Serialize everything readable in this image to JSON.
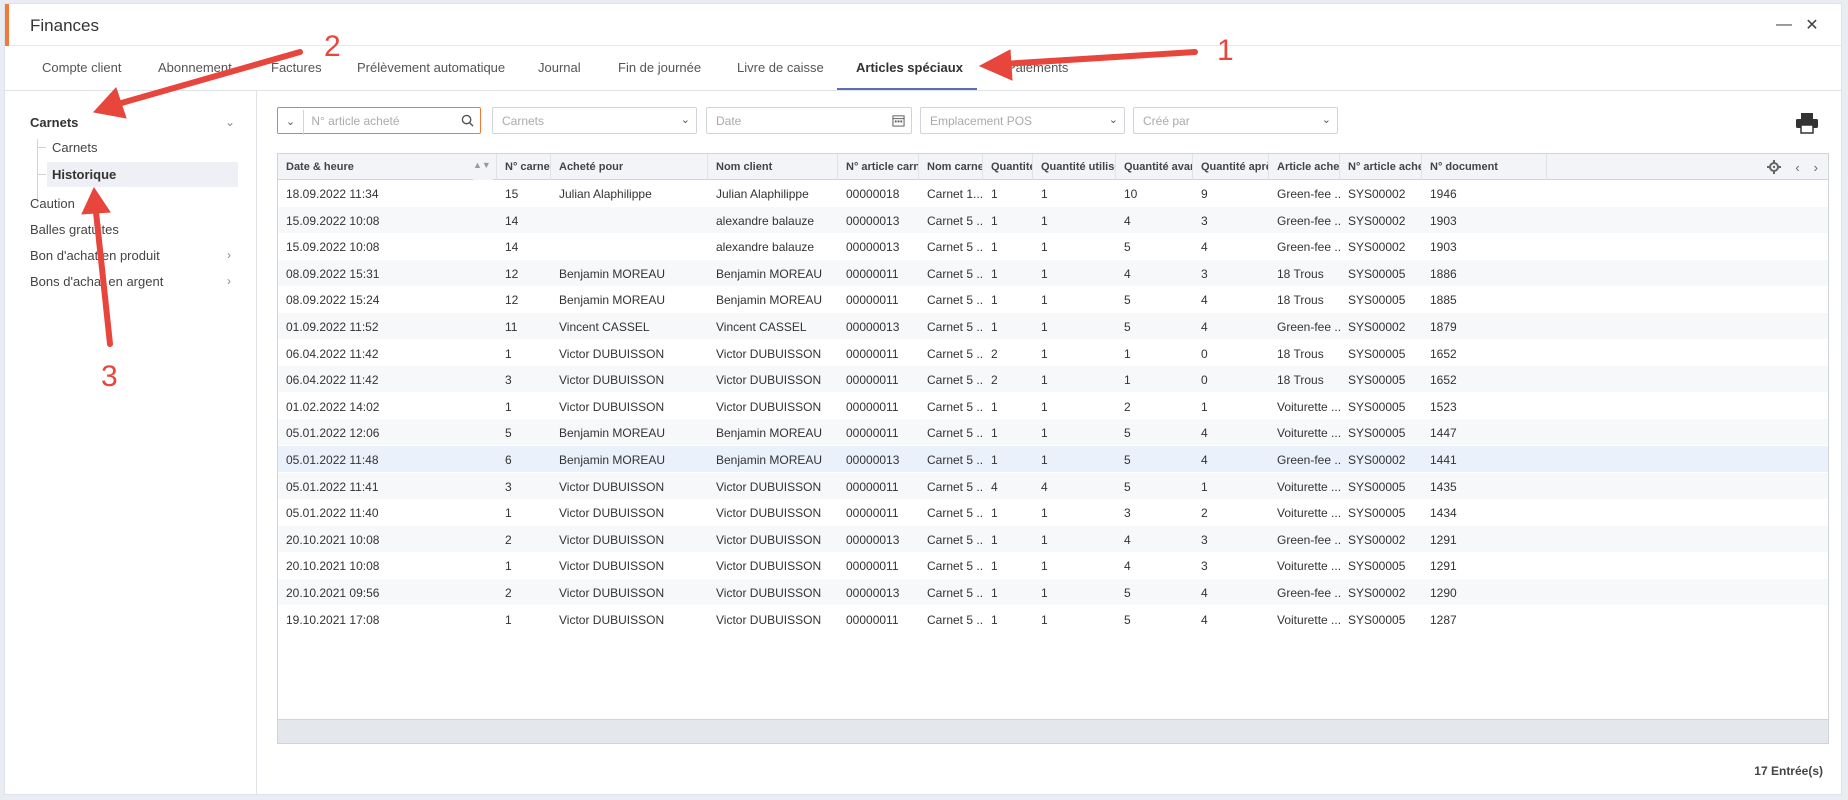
{
  "window": {
    "title": "Finances"
  },
  "tabs": [
    {
      "label": "Compte client",
      "active": false
    },
    {
      "label": "Abonnement",
      "active": false
    },
    {
      "label": "Factures",
      "active": false
    },
    {
      "label": "Prélèvement automatique",
      "active": false
    },
    {
      "label": "Journal",
      "active": false
    },
    {
      "label": "Fin de journée",
      "active": false
    },
    {
      "label": "Livre de caisse",
      "active": false
    },
    {
      "label": "Articles spéciaux",
      "active": true
    },
    {
      "label": "Paiements",
      "active": false
    }
  ],
  "sidebar": {
    "group_label": "Carnets",
    "sub_items": [
      {
        "label": "Carnets",
        "active": false
      },
      {
        "label": "Historique",
        "active": true
      }
    ],
    "items": [
      {
        "label": "Caution"
      },
      {
        "label": "Balles gratuites"
      },
      {
        "label": "Bon d'achat en produit"
      },
      {
        "label": "Bons d'achat en argent"
      }
    ]
  },
  "filters": {
    "search_placeholder": "N° article acheté",
    "carnets": "Carnets",
    "date": "Date",
    "emplacement": "Emplacement POS",
    "cree_par": "Créé par"
  },
  "icons": {
    "print": "print-icon",
    "search": "search-icon",
    "settings": "gear-icon",
    "prev": "chevron-left-icon",
    "next": "chevron-right-icon",
    "calendar": "calendar-icon"
  },
  "table": {
    "columns": [
      "Date & heure",
      "N° carnet",
      "Acheté pour",
      "Nom client",
      "N° article carnet",
      "Nom carnet",
      "Quantité",
      "Quantité utilisée",
      "Quantité avant",
      "Quantité après",
      "Article acheté",
      "N° article acheté",
      "N° document"
    ],
    "rows": [
      [
        "18.09.2022 11:34",
        "15",
        "Julian Alaphilippe",
        "Julian Alaphilippe",
        "00000018",
        "Carnet 1...",
        "1",
        "1",
        "10",
        "9",
        "Green-fee ...",
        "SYS00002",
        "1946"
      ],
      [
        "15.09.2022 10:08",
        "14",
        "",
        "alexandre balauze",
        "00000013",
        "Carnet 5 ...",
        "1",
        "1",
        "4",
        "3",
        "Green-fee ...",
        "SYS00002",
        "1903"
      ],
      [
        "15.09.2022 10:08",
        "14",
        "",
        "alexandre balauze",
        "00000013",
        "Carnet 5 ...",
        "1",
        "1",
        "5",
        "4",
        "Green-fee ...",
        "SYS00002",
        "1903"
      ],
      [
        "08.09.2022 15:31",
        "12",
        "Benjamin MOREAU",
        "Benjamin MOREAU",
        "00000011",
        "Carnet 5 ...",
        "1",
        "1",
        "4",
        "3",
        "18 Trous",
        "SYS00005",
        "1886"
      ],
      [
        "08.09.2022 15:24",
        "12",
        "Benjamin MOREAU",
        "Benjamin MOREAU",
        "00000011",
        "Carnet 5 ...",
        "1",
        "1",
        "5",
        "4",
        "18 Trous",
        "SYS00005",
        "1885"
      ],
      [
        "01.09.2022 11:52",
        "11",
        "Vincent CASSEL",
        "Vincent CASSEL",
        "00000013",
        "Carnet 5 ...",
        "1",
        "1",
        "5",
        "4",
        "Green-fee ...",
        "SYS00002",
        "1879"
      ],
      [
        "06.04.2022 11:42",
        "1",
        "Victor DUBUISSON",
        "Victor DUBUISSON",
        "00000011",
        "Carnet 5 ...",
        "2",
        "1",
        "1",
        "0",
        "18 Trous",
        "SYS00005",
        "1652"
      ],
      [
        "06.04.2022 11:42",
        "3",
        "Victor DUBUISSON",
        "Victor DUBUISSON",
        "00000011",
        "Carnet 5 ...",
        "2",
        "1",
        "1",
        "0",
        "18 Trous",
        "SYS00005",
        "1652"
      ],
      [
        "01.02.2022 14:02",
        "1",
        "Victor DUBUISSON",
        "Victor DUBUISSON",
        "00000011",
        "Carnet 5 ...",
        "1",
        "1",
        "2",
        "1",
        "Voiturette ...",
        "SYS00005",
        "1523"
      ],
      [
        "05.01.2022 12:06",
        "5",
        "Benjamin MOREAU",
        "Benjamin MOREAU",
        "00000011",
        "Carnet 5 ...",
        "1",
        "1",
        "5",
        "4",
        "Voiturette ...",
        "SYS00005",
        "1447"
      ],
      [
        "05.01.2022 11:48",
        "6",
        "Benjamin MOREAU",
        "Benjamin MOREAU",
        "00000013",
        "Carnet 5 ...",
        "1",
        "1",
        "5",
        "4",
        "Green-fee ...",
        "SYS00002",
        "1441"
      ],
      [
        "05.01.2022 11:41",
        "3",
        "Victor DUBUISSON",
        "Victor DUBUISSON",
        "00000011",
        "Carnet 5 ...",
        "4",
        "4",
        "5",
        "1",
        "Voiturette ...",
        "SYS00005",
        "1435"
      ],
      [
        "05.01.2022 11:40",
        "1",
        "Victor DUBUISSON",
        "Victor DUBUISSON",
        "00000011",
        "Carnet 5 ...",
        "1",
        "1",
        "3",
        "2",
        "Voiturette ...",
        "SYS00005",
        "1434"
      ],
      [
        "20.10.2021 10:08",
        "2",
        "Victor DUBUISSON",
        "Victor DUBUISSON",
        "00000013",
        "Carnet 5 ...",
        "1",
        "1",
        "4",
        "3",
        "Green-fee ...",
        "SYS00002",
        "1291"
      ],
      [
        "20.10.2021 10:08",
        "1",
        "Victor DUBUISSON",
        "Victor DUBUISSON",
        "00000011",
        "Carnet 5 ...",
        "1",
        "1",
        "4",
        "3",
        "Voiturette ...",
        "SYS00005",
        "1291"
      ],
      [
        "20.10.2021 09:56",
        "2",
        "Victor DUBUISSON",
        "Victor DUBUISSON",
        "00000013",
        "Carnet 5 ...",
        "1",
        "1",
        "5",
        "4",
        "Green-fee ...",
        "SYS00002",
        "1290"
      ],
      [
        "19.10.2021 17:08",
        "1",
        "Victor DUBUISSON",
        "Victor DUBUISSON",
        "00000011",
        "Carnet 5 ...",
        "1",
        "1",
        "5",
        "4",
        "Voiturette ...",
        "SYS00005",
        "1287"
      ]
    ]
  },
  "footer": {
    "entries": "17 Entrée(s)"
  },
  "annotations": [
    {
      "label": "1"
    },
    {
      "label": "2"
    },
    {
      "label": "3"
    }
  ],
  "colors": {
    "accent": "#f07a3a",
    "annotation": "#e8453c",
    "tab_underline": "#5b6fb5"
  }
}
